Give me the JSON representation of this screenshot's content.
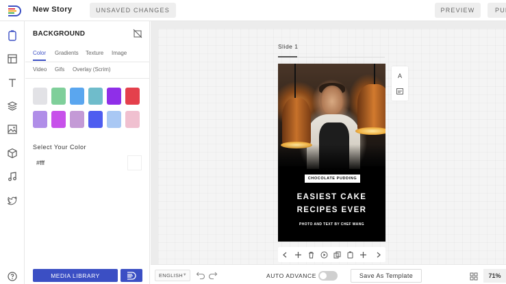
{
  "header": {
    "story_title": "New Story",
    "unsaved_label": "UNSAVED CHANGES",
    "preview_label": "PREVIEW",
    "publish_label": "PUBLISH"
  },
  "rail": {
    "items": [
      {
        "name": "stories-icon"
      },
      {
        "name": "templates-icon"
      },
      {
        "name": "text-icon"
      },
      {
        "name": "layers-icon"
      },
      {
        "name": "image-icon"
      },
      {
        "name": "3d-box-icon"
      },
      {
        "name": "music-icon"
      },
      {
        "name": "twitter-icon"
      },
      {
        "name": "help-icon"
      }
    ]
  },
  "panel": {
    "title": "BACKGROUND",
    "tabs_row1": [
      "Color",
      "Gradients",
      "Texture",
      "Image"
    ],
    "tabs_row2": [
      "Video",
      "Gifs",
      "Overlay (Scrim)"
    ],
    "active_tab": "Color",
    "swatches": [
      "#e2e2e6",
      "#7fcf9a",
      "#5aa6ef",
      "#6fbccb",
      "#8f2fe8",
      "#e4404c",
      "#b08ee8",
      "#c751ea",
      "#c49ad6",
      "#4e5df0",
      "#a9c8f4",
      "#f0c0d0"
    ],
    "select_color_label": "Select Your Color",
    "hex_value": "#fff",
    "media_library_label": "MEDIA LIBRARY"
  },
  "canvas": {
    "slide_label": "Slide 1",
    "slide": {
      "tag": "CHOCOLATE PUDDING",
      "headline_line1": "EASIEST CAKE",
      "headline_line2": "RECIPES EVER",
      "credit": "PHOTO AND TEXT BY CHEF WANG"
    },
    "float_tools": {
      "text_tool_glyph": "A"
    }
  },
  "bottombar": {
    "language": "ENGLISH",
    "auto_advance_label": "AUTO ADVANCE",
    "auto_advance_on": false,
    "save_template_label": "Save As Template",
    "zoom": "71%"
  },
  "colors": {
    "accent": "#3b4fc4",
    "slide_bg": "#000000",
    "canvas_bg": "#f4f4f4"
  }
}
